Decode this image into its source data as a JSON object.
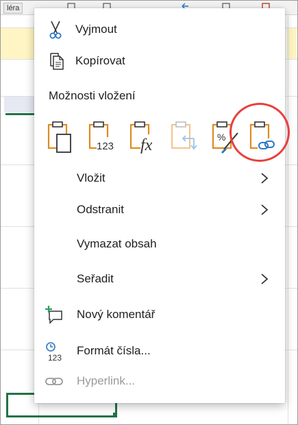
{
  "sheet": {
    "tab_label": "léra"
  },
  "menu": {
    "items_top": [
      {
        "id": "cut",
        "label": "Vyjmout",
        "icon": "scissors-icon"
      },
      {
        "id": "copy",
        "label": "Kopírovat",
        "icon": "copy-icon"
      }
    ],
    "paste_options_title": "Možnosti vložení",
    "paste_options": [
      {
        "id": "paste",
        "icon": "paste-icon"
      },
      {
        "id": "paste-values",
        "icon": "paste-values-icon",
        "glyph": "123"
      },
      {
        "id": "paste-formulas",
        "icon": "paste-formulas-icon",
        "glyph": "fx"
      },
      {
        "id": "paste-transpose",
        "icon": "paste-transpose-icon",
        "disabled": true
      },
      {
        "id": "paste-formatting",
        "icon": "paste-formatting-icon"
      },
      {
        "id": "paste-link",
        "icon": "paste-link-icon",
        "highlighted": true
      }
    ],
    "items": [
      {
        "id": "insert",
        "label": "Vložit",
        "submenu": true
      },
      {
        "id": "delete",
        "label": "Odstranit",
        "submenu": true
      },
      {
        "id": "clear",
        "label": "Vymazat obsah"
      },
      {
        "id": "sort",
        "label": "Seřadit",
        "submenu": true
      },
      {
        "id": "comment",
        "label": "Nový komentář",
        "icon": "new-comment-icon"
      },
      {
        "id": "numfmt",
        "label": "Formát čísla...",
        "icon": "number-format-icon"
      },
      {
        "id": "hyperlink",
        "label": "Hyperlink...",
        "icon": "link-icon",
        "disabled": true
      }
    ]
  },
  "colors": {
    "accent_blue": "#2b78c2",
    "paste_orange": "#e08a1e",
    "highlight_red": "#e8403c",
    "excel_green": "#217346"
  }
}
